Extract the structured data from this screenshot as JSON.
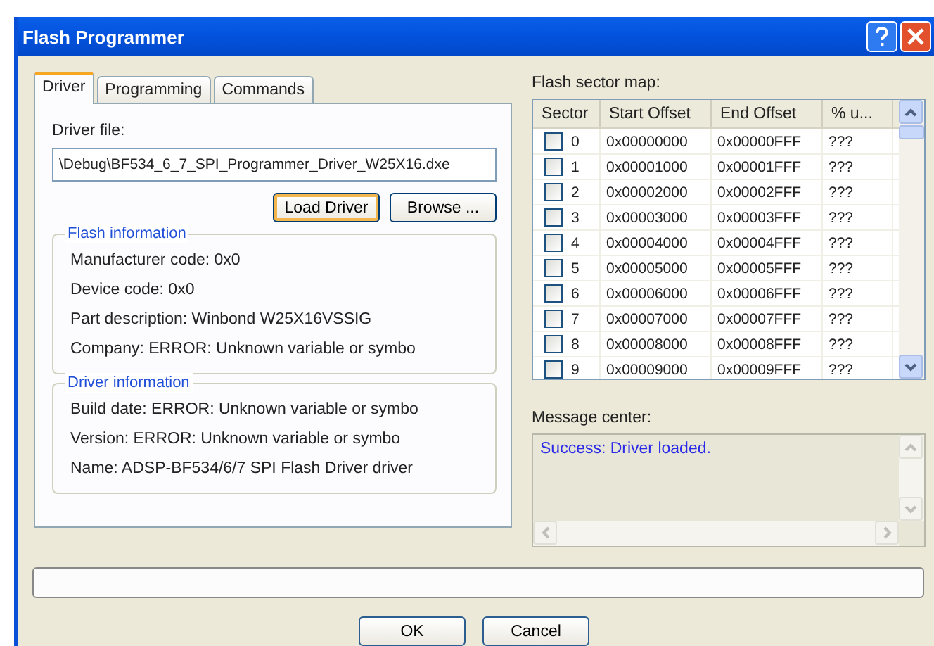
{
  "window": {
    "title": "Flash Programmer"
  },
  "tabs": [
    {
      "label": "Driver",
      "selected": true
    },
    {
      "label": "Programming",
      "selected": false
    },
    {
      "label": "Commands",
      "selected": false
    }
  ],
  "driver_file": {
    "label": "Driver file:",
    "value": "\\Debug\\BF534_6_7_SPI_Programmer_Driver_W25X16.dxe"
  },
  "driver_buttons": [
    {
      "label": "Load Driver",
      "focused": true
    },
    {
      "label": "Browse ...",
      "focused": false
    }
  ],
  "groups": [
    {
      "title": "Flash information",
      "lines": [
        "Manufacturer code:  0x0",
        "Device code:  0x0",
        "Part description:  Winbond W25X16VSSIG",
        "Company:  ERROR: Unknown variable or symbo"
      ]
    },
    {
      "title": "Driver information",
      "lines": [
        "Build date:  ERROR: Unknown variable or symbo",
        "Version:  ERROR: Unknown variable or symbo",
        "Name:  ADSP-BF534/6/7 SPI Flash Driver driver"
      ]
    }
  ],
  "sector_map": {
    "label": "Flash sector map:",
    "columns": [
      "Sector",
      "Start Offset",
      "End Offset",
      "% u..."
    ],
    "rows": [
      {
        "sector": "0",
        "start": "0x00000000",
        "end": "0x00000FFF",
        "usage": "???",
        "checked": false
      },
      {
        "sector": "1",
        "start": "0x00001000",
        "end": "0x00001FFF",
        "usage": "???",
        "checked": false
      },
      {
        "sector": "2",
        "start": "0x00002000",
        "end": "0x00002FFF",
        "usage": "???",
        "checked": false
      },
      {
        "sector": "3",
        "start": "0x00003000",
        "end": "0x00003FFF",
        "usage": "???",
        "checked": false
      },
      {
        "sector": "4",
        "start": "0x00004000",
        "end": "0x00004FFF",
        "usage": "???",
        "checked": false
      },
      {
        "sector": "5",
        "start": "0x00005000",
        "end": "0x00005FFF",
        "usage": "???",
        "checked": false
      },
      {
        "sector": "6",
        "start": "0x00006000",
        "end": "0x00006FFF",
        "usage": "???",
        "checked": false
      },
      {
        "sector": "7",
        "start": "0x00007000",
        "end": "0x00007FFF",
        "usage": "???",
        "checked": false
      },
      {
        "sector": "8",
        "start": "0x00008000",
        "end": "0x00008FFF",
        "usage": "???",
        "checked": false
      },
      {
        "sector": "9",
        "start": "0x00009000",
        "end": "0x00009FFF",
        "usage": "???",
        "checked": false
      }
    ]
  },
  "message_center": {
    "label": "Message center:",
    "messages": [
      "Success: Driver loaded."
    ]
  },
  "dialog_buttons": [
    "OK",
    "Cancel"
  ]
}
